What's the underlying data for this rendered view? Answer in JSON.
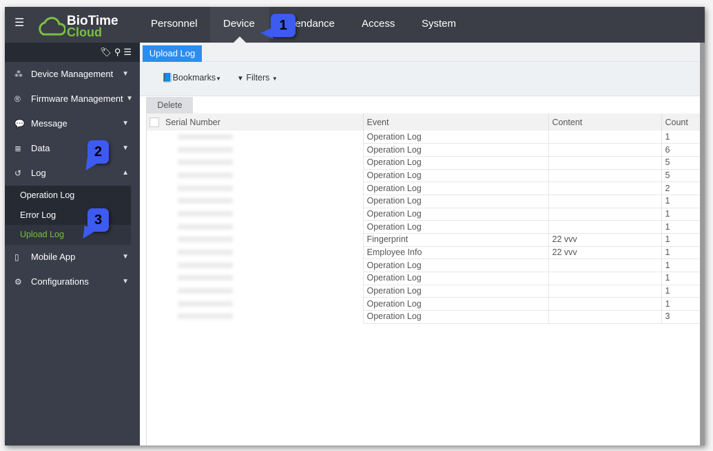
{
  "app": {
    "logo_line1": "BioTime",
    "logo_line2": "Cloud"
  },
  "nav": [
    {
      "label": "Personnel"
    },
    {
      "label": "Device",
      "active": true
    },
    {
      "label": "Attendance"
    },
    {
      "label": "Access"
    },
    {
      "label": "System"
    }
  ],
  "sidebar": {
    "items": [
      {
        "label": "Device Management",
        "icon": "devices-icon"
      },
      {
        "label": "Firmware Management",
        "icon": "registered-icon"
      },
      {
        "label": "Message",
        "icon": "chat-icon"
      },
      {
        "label": "Data",
        "icon": "database-icon"
      },
      {
        "label": "Log",
        "icon": "history-icon",
        "expanded": true
      },
      {
        "label": "Mobile App",
        "icon": "mobile-icon"
      },
      {
        "label": "Configurations",
        "icon": "gears-icon"
      }
    ],
    "log_sub": [
      {
        "label": "Operation Log"
      },
      {
        "label": "Error Log"
      },
      {
        "label": "Upload Log",
        "selected": true
      }
    ]
  },
  "tabs": {
    "active": "Upload Log"
  },
  "toolbar": {
    "bookmarks": "Bookmarks",
    "filters": "Filters",
    "delete": "Delete"
  },
  "table": {
    "columns": [
      "Serial Number",
      "Event",
      "Content",
      "Count"
    ],
    "rows": [
      {
        "event": "Operation Log",
        "content": "",
        "count": "1"
      },
      {
        "event": "Operation Log",
        "content": "",
        "count": "6"
      },
      {
        "event": "Operation Log",
        "content": "",
        "count": "5"
      },
      {
        "event": "Operation Log",
        "content": "",
        "count": "5"
      },
      {
        "event": "Operation Log",
        "content": "",
        "count": "2"
      },
      {
        "event": "Operation Log",
        "content": "",
        "count": "1"
      },
      {
        "event": "Operation Log",
        "content": "",
        "count": "1"
      },
      {
        "event": "Operation Log",
        "content": "",
        "count": "1"
      },
      {
        "event": "Fingerprint",
        "content": "22 vvv",
        "count": "1"
      },
      {
        "event": "Employee Info",
        "content": "22 vvv",
        "count": "1"
      },
      {
        "event": "Operation Log",
        "content": "",
        "count": "1"
      },
      {
        "event": "Operation Log",
        "content": "",
        "count": "1"
      },
      {
        "event": "Operation Log",
        "content": "",
        "count": "1"
      },
      {
        "event": "Operation Log",
        "content": "",
        "count": "1"
      },
      {
        "event": "Operation Log",
        "content": "",
        "count": "3"
      }
    ]
  },
  "callouts": [
    "1",
    "2",
    "3"
  ],
  "colors": {
    "accent": "#2d8cf0",
    "brand_green": "#7ac143",
    "callout": "#3d5af1"
  }
}
